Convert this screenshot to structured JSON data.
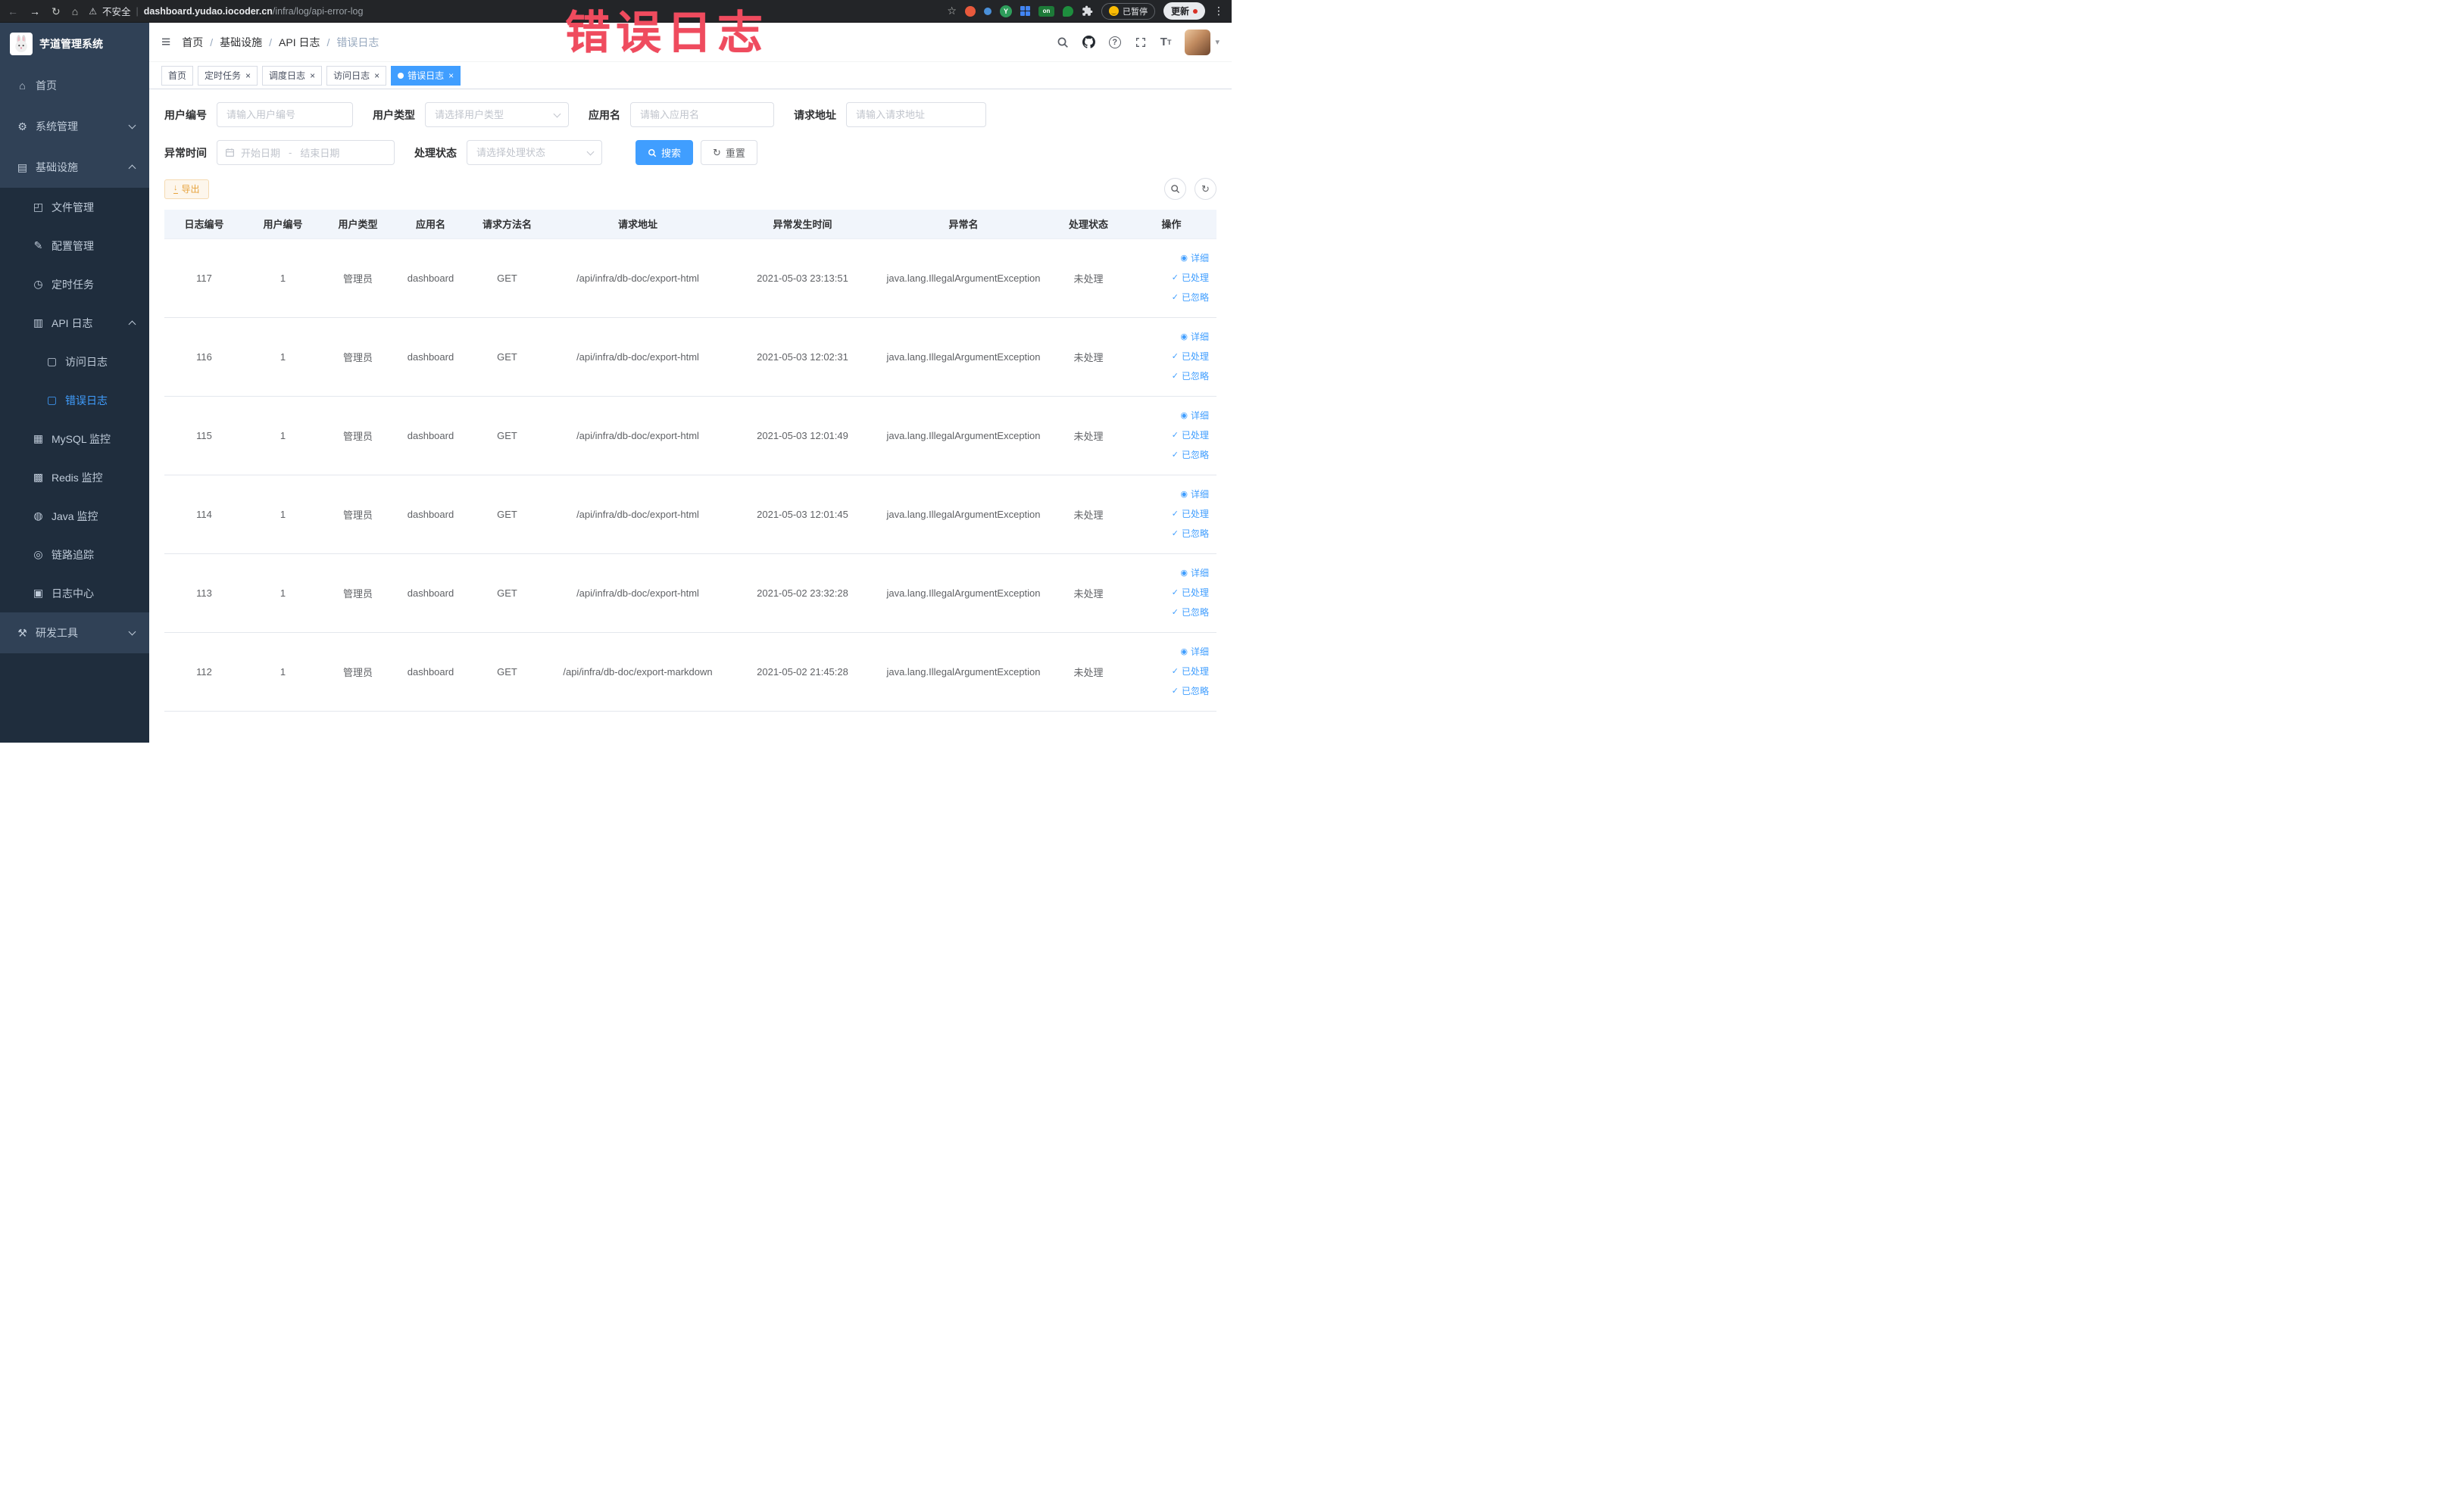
{
  "browser": {
    "security_label": "不安全",
    "url_host": "dashboard.yudao.iocoder.cn",
    "url_path": "/infra/log/api-error-log",
    "paused_badge_label": "已暂停",
    "update_button_label": "更新",
    "extension_on_label": "on",
    "extension_y_label": "Y"
  },
  "annotation": {
    "text": "错误日志",
    "color": "#ef4b5e"
  },
  "sidebar": {
    "logo_title": "芋道管理系统",
    "items": [
      {
        "label": "首页"
      },
      {
        "label": "系统管理"
      },
      {
        "label": "基础设施"
      },
      {
        "label": "文件管理"
      },
      {
        "label": "配置管理"
      },
      {
        "label": "定时任务"
      },
      {
        "label": "API 日志"
      },
      {
        "label": "访问日志"
      },
      {
        "label": "错误日志"
      },
      {
        "label": "MySQL 监控"
      },
      {
        "label": "Redis 监控"
      },
      {
        "label": "Java 监控"
      },
      {
        "label": "链路追踪"
      },
      {
        "label": "日志中心"
      },
      {
        "label": "研发工具"
      }
    ]
  },
  "header": {
    "breadcrumb": [
      "首页",
      "基础设施",
      "API 日志",
      "错误日志"
    ]
  },
  "tabs": [
    {
      "label": "首页"
    },
    {
      "label": "定时任务"
    },
    {
      "label": "调度日志"
    },
    {
      "label": "访问日志"
    },
    {
      "label": "错误日志"
    }
  ],
  "filters": {
    "user_id_label": "用户编号",
    "user_id_placeholder": "请输入用户编号",
    "user_type_label": "用户类型",
    "user_type_placeholder": "请选择用户类型",
    "app_name_label": "应用名",
    "app_name_placeholder": "请输入应用名",
    "request_url_label": "请求地址",
    "request_url_placeholder": "请输入请求地址",
    "exception_time_label": "异常时间",
    "date_start_placeholder": "开始日期",
    "date_separator": "-",
    "date_end_placeholder": "结束日期",
    "status_label": "处理状态",
    "status_placeholder": "请选择处理状态",
    "search_label": "搜索",
    "reset_label": "重置"
  },
  "toolbar": {
    "export_label": "导出"
  },
  "table": {
    "columns": [
      "日志编号",
      "用户编号",
      "用户类型",
      "应用名",
      "请求方法名",
      "请求地址",
      "异常发生时间",
      "异常名",
      "处理状态",
      "操作"
    ],
    "action_labels": [
      "详细",
      "已处理",
      "已忽略"
    ],
    "rows": [
      {
        "id": "117",
        "user_id": "1",
        "user_type": "管理员",
        "app_name": "dashboard",
        "method": "GET",
        "url": "/api/infra/db-doc/export-html",
        "time": "2021-05-03 23:13:51",
        "exception": "java.lang.IllegalArgumentException",
        "status": "未处理"
      },
      {
        "id": "116",
        "user_id": "1",
        "user_type": "管理员",
        "app_name": "dashboard",
        "method": "GET",
        "url": "/api/infra/db-doc/export-html",
        "time": "2021-05-03 12:02:31",
        "exception": "java.lang.IllegalArgumentException",
        "status": "未处理"
      },
      {
        "id": "115",
        "user_id": "1",
        "user_type": "管理员",
        "app_name": "dashboard",
        "method": "GET",
        "url": "/api/infra/db-doc/export-html",
        "time": "2021-05-03 12:01:49",
        "exception": "java.lang.IllegalArgumentException",
        "status": "未处理"
      },
      {
        "id": "114",
        "user_id": "1",
        "user_type": "管理员",
        "app_name": "dashboard",
        "method": "GET",
        "url": "/api/infra/db-doc/export-html",
        "time": "2021-05-03 12:01:45",
        "exception": "java.lang.IllegalArgumentException",
        "status": "未处理"
      },
      {
        "id": "113",
        "user_id": "1",
        "user_type": "管理员",
        "app_name": "dashboard",
        "method": "GET",
        "url": "/api/infra/db-doc/export-html",
        "time": "2021-05-02 23:32:28",
        "exception": "java.lang.IllegalArgumentException",
        "status": "未处理"
      },
      {
        "id": "112",
        "user_id": "1",
        "user_type": "管理员",
        "app_name": "dashboard",
        "method": "GET",
        "url": "/api/infra/db-doc/export-markdown",
        "time": "2021-05-02 21:45:28",
        "exception": "java.lang.IllegalArgumentException",
        "status": "未处理"
      }
    ]
  },
  "colors": {
    "accent": "#409eff",
    "warning": "#e6a23c",
    "annotation": "#ef4b5e",
    "sidebar_bg": "#304156",
    "sidebar_submenu_bg": "#1f2d3d",
    "table_header_bg": "#f1f5fb"
  }
}
